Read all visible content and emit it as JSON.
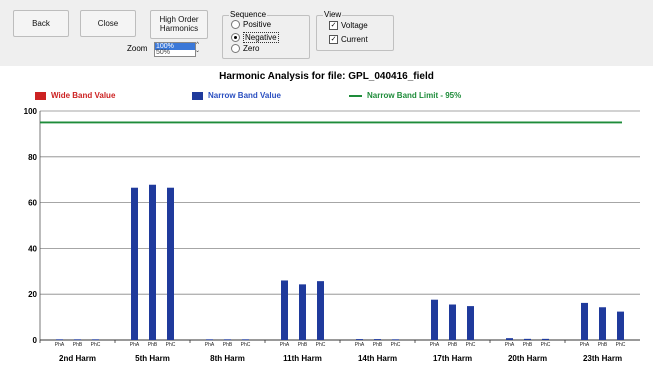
{
  "toolbar": {
    "back_label": "Back",
    "close_label": "Close",
    "high_order_line1": "High Order",
    "high_order_line2": "Harmonics",
    "zoom_label": "Zoom",
    "zoom_selected": "100%",
    "zoom_next": "50%"
  },
  "sequence": {
    "title": "Sequence",
    "options": [
      "Positive",
      "Negative",
      "Zero"
    ],
    "selected": "Negative"
  },
  "view": {
    "title": "View",
    "options": [
      "Voltage",
      "Current"
    ],
    "voltage_checked": true,
    "current_checked": true
  },
  "colors": {
    "wide": "#cc2222",
    "narrow": "#1f3a9c",
    "limit": "#1e8c3a"
  },
  "chart_data": {
    "type": "bar",
    "title": "Harmonic Analysis for file: GPL_040416_field",
    "legend": [
      {
        "name": "Wide Band Value",
        "color": "#cc2222"
      },
      {
        "name": "Narrow Band Value",
        "color": "#1f3a9c"
      },
      {
        "name": "Narrow Band Limit - 95%",
        "color": "#1e8c3a"
      }
    ],
    "ylim": [
      0,
      100
    ],
    "yticks": [
      0,
      20,
      40,
      60,
      80,
      100
    ],
    "grid": true,
    "limit_value": 95,
    "groups": [
      "2nd Harm",
      "5th Harm",
      "8th Harm",
      "11th Harm",
      "14th Harm",
      "17th Harm",
      "20th Harm",
      "23th Harm"
    ],
    "phases": [
      "PhA",
      "PhB",
      "PhC"
    ],
    "narrow_values": [
      [
        0.3,
        0.3,
        0.3
      ],
      [
        66.5,
        67.8,
        66.5
      ],
      [
        0.3,
        0.3,
        0.3
      ],
      [
        26,
        24.3,
        25.7
      ],
      [
        0.4,
        0.4,
        0.3
      ],
      [
        17.6,
        15.5,
        14.8
      ],
      [
        0.8,
        0.5,
        0.5
      ],
      [
        16.2,
        14.3,
        12.4
      ]
    ]
  }
}
